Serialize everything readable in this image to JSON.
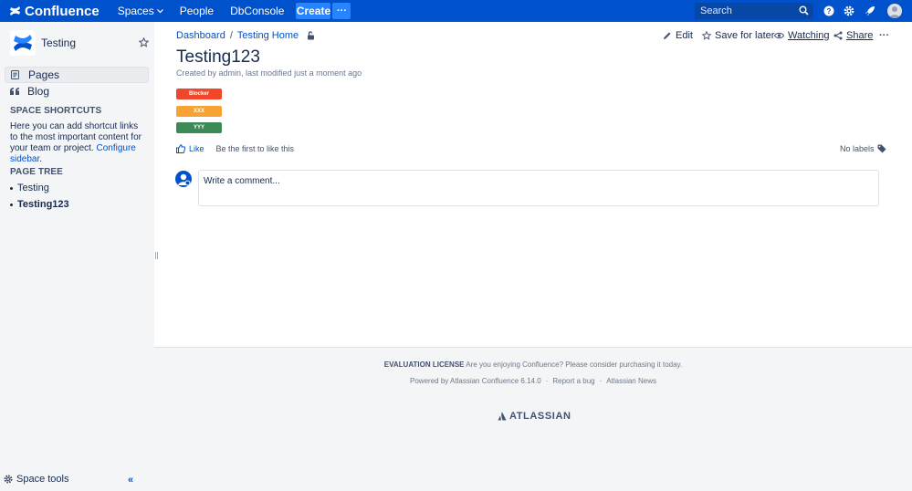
{
  "nav": {
    "brand": "Confluence",
    "spaces": "Spaces",
    "people": "People",
    "dbconsole": "DbConsole",
    "create": "Create",
    "more": "···",
    "search_placeholder": "Search"
  },
  "sidebar": {
    "space_name": "Testing",
    "pages": "Pages",
    "blog": "Blog",
    "shortcuts_heading": "SPACE SHORTCUTS",
    "shortcuts_text": "Here you can add shortcut links to the most important content for your team or project. ",
    "configure_link": "Configure sidebar",
    "configure_suffix": ".",
    "tree_heading": "PAGE TREE",
    "tree": [
      "Testing",
      "Testing123"
    ],
    "space_tools": "Space tools",
    "collapse": "«"
  },
  "page": {
    "breadcrumb": [
      "Dashboard",
      "Testing Home"
    ],
    "breadcrumb_sep": "/",
    "actions": {
      "edit": "Edit",
      "save_later": "Save for later",
      "watching": "Watching",
      "share": "Share",
      "more": "···"
    },
    "title": "Testing123",
    "byline_prefix": "Created by ",
    "byline_author": "admin",
    "byline_middle": ", last modified ",
    "byline_time": "just a moment ago",
    "statuses": [
      {
        "label": "Blocker",
        "color": "#f0472a"
      },
      {
        "label": "XXX",
        "color": "#f7a233"
      },
      {
        "label": "YYY",
        "color": "#3c8a55"
      }
    ],
    "like": "Like",
    "first_like": "Be the first to like this",
    "no_labels": "No labels",
    "comment_placeholder": "Write a comment..."
  },
  "footer": {
    "license_bold": "EVALUATION LICENSE",
    "license_text": " Are you enjoying Confluence? Please consider purchasing it today.",
    "powered": "Powered by Atlassian Confluence 6.14.0",
    "report": "Report a bug",
    "news": "Atlassian News",
    "atlassian": "ATLASSIAN"
  },
  "colors": {
    "nav_bg": "#0052cc",
    "link": "#0052cc",
    "sidebar_bg": "#f4f5f7"
  }
}
